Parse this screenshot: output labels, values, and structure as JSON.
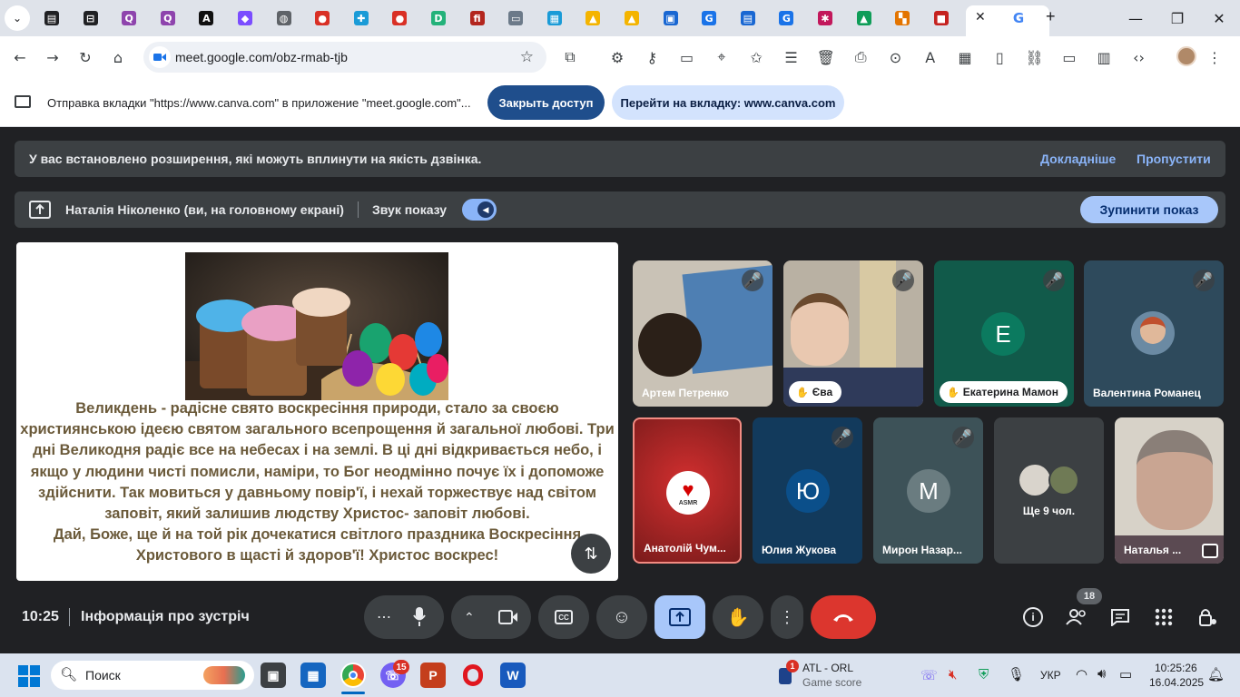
{
  "browser": {
    "tabs": [
      {
        "icon": "tab-list-icon",
        "color": "#202124"
      },
      {
        "icon": "tab-menu-icon",
        "color": "#202124"
      },
      {
        "icon": "quizizz-icon",
        "color": "#8e44ad"
      },
      {
        "icon": "quizizz-icon",
        "color": "#8e44ad"
      },
      {
        "icon": "aiart-icon",
        "color": "#111111"
      },
      {
        "icon": "cube-icon",
        "color": "#7b4dff"
      },
      {
        "icon": "globe-icon",
        "color": "#5f6368"
      },
      {
        "icon": "red-ball-icon",
        "color": "#d93025"
      },
      {
        "icon": "puzzle-icon",
        "color": "#1a9bd7"
      },
      {
        "icon": "red-ball-icon",
        "color": "#d93025"
      },
      {
        "icon": "d-icon",
        "color": "#23b27a"
      },
      {
        "icon": "fi-icon",
        "color": "#b3261e"
      },
      {
        "icon": "screen-icon",
        "color": "#6c7a89"
      },
      {
        "icon": "grid-icon",
        "color": "#1a9bd7"
      },
      {
        "icon": "bell-icon",
        "color": "#f4b400"
      },
      {
        "icon": "bell-icon",
        "color": "#f4b400"
      },
      {
        "icon": "tv-icon",
        "color": "#1967d2"
      },
      {
        "icon": "g-icon",
        "color": "#1a73e8"
      },
      {
        "icon": "sites-icon",
        "color": "#1967d2"
      },
      {
        "icon": "g-icon",
        "color": "#1a73e8"
      },
      {
        "icon": "pattern-icon",
        "color": "#c2185b"
      },
      {
        "icon": "drive-icon",
        "color": "#0f9d58"
      },
      {
        "icon": "tiles-icon",
        "color": "#e37400"
      },
      {
        "icon": "red-square-icon",
        "color": "#c5221f"
      },
      {
        "icon": "d-icon",
        "color": "#188038"
      }
    ],
    "active_tab_icon": "google-icon",
    "url": "meet.google.com/obz-rmab-tjb"
  },
  "sharebar": {
    "message": "Отправка вкладки \"https://www.canva.com\" в приложение \"meet.google.com\"...",
    "stop_label": "Закрыть доступ",
    "goto_label": "Перейти на вкладку: www.canva.com"
  },
  "meet": {
    "notice": {
      "text": "У вас встановлено розширення, які можуть вплинути на якість дзвінка.",
      "more": "Докладніше",
      "skip": "Пропустити"
    },
    "presenting": {
      "who": "Наталія Ніколенко (ви, на головному екрані)",
      "sound": "Звук показу",
      "stop": "Зупинити показ"
    },
    "slide": {
      "lines": [
        "Великдень - радісне свято воскресіння природи, стало за своєю",
        "християнською ідеєю святом загального всепрощення й загальної любові. Три",
        "дні Великодня радіє все на небесах і на землі. В ці дні відкривається небо, і",
        "якщо у людини чисті помисли, наміри, то Бог неодмінно почує їх і допоможе",
        "здійснити. Так мовиться у давньому повір'ї, і нехай торжествує над світом",
        "заповіт, який залишив людству Христос- заповіт любові.",
        "Дай, Боже, ще й на той рік дочекатися світлого праздника Воскресіння",
        "Христового в щасті й здоров'ї! Христос воскрес!"
      ]
    },
    "participants": {
      "p1": "Артем Петренко",
      "p2": "Єва",
      "p3": "Екатерина Мамон",
      "p3_initial": "E",
      "p4": "Валентина Романец",
      "p5": "Анатолій Чум...",
      "p5_badge": "ASMR",
      "p6": "Юлия Жукова",
      "p6_initial": "Ю",
      "p7": "Мирон Назар...",
      "p7_initial": "M",
      "p8": "Ще 9 чол.",
      "p9": "Наталья ..."
    },
    "time": "10:25",
    "meeting_info": "Інформація про зустріч",
    "people_count": "18"
  },
  "taskbar": {
    "search": "Поиск",
    "chat_badge": "15",
    "news_badge": "1",
    "news_title": "ATL - ORL",
    "news_sub": "Game score",
    "lang": "УКР",
    "clock_time": "10:25:26",
    "clock_date": "16.04.2025"
  }
}
